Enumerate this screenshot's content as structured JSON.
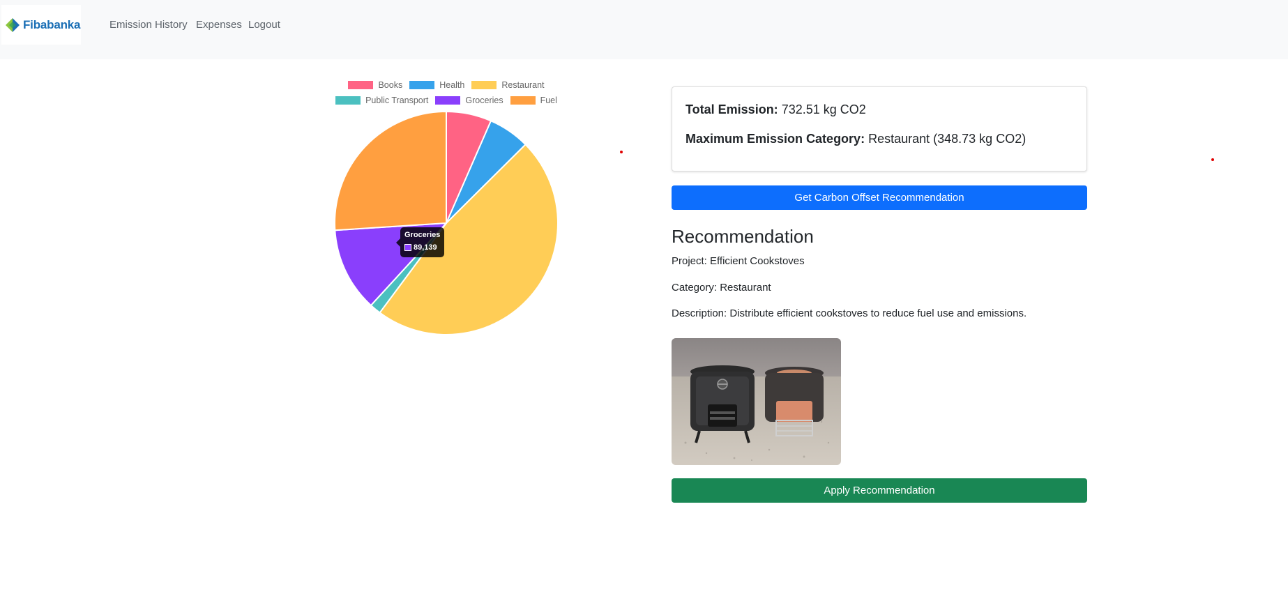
{
  "brand": {
    "name": "Fibabanka"
  },
  "nav": {
    "links": [
      {
        "label": "Emission History"
      },
      {
        "label": "Expenses"
      },
      {
        "label": "Logout"
      }
    ]
  },
  "chart_data": {
    "type": "pie",
    "categories": [
      "Books",
      "Health",
      "Restaurant",
      "Public Transport",
      "Groceries",
      "Fuel"
    ],
    "values": [
      48,
      44,
      348.73,
      12,
      89.139,
      190.64
    ],
    "colors": [
      "#ff6384",
      "#36a2eb",
      "#ffcd56",
      "#4bc0c0",
      "#8a3ffc",
      "#ff9f40"
    ],
    "legend_position": "top",
    "tooltip": {
      "label": "Groceries",
      "value": "89,139"
    }
  },
  "summary": {
    "total_label": "Total Emission:",
    "total_value": "732.51 kg CO2",
    "max_label": "Maximum Emission Category:",
    "max_value": "Restaurant (348.73 kg CO2)"
  },
  "actions": {
    "recommend_label": "Get Carbon Offset Recommendation",
    "apply_label": "Apply Recommendation",
    "recommend_color": "#0d6efd",
    "apply_color": "#198754"
  },
  "recommendation": {
    "heading": "Recommendation",
    "project": "Project: Efficient Cookstoves",
    "category": "Category: Restaurant",
    "description": "Description: Distribute efficient cookstoves to reduce fuel use and emissions."
  }
}
